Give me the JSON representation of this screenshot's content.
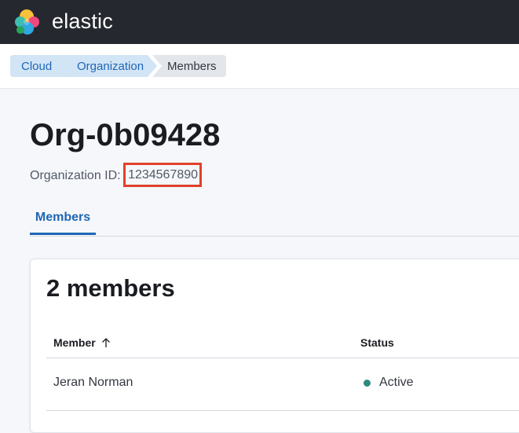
{
  "header": {
    "brand": "elastic"
  },
  "breadcrumbs": [
    "Cloud",
    "Organization",
    "Members"
  ],
  "page": {
    "title": "Org-0b09428",
    "org_id_label": "Organization ID:",
    "org_id_value": "1234567890"
  },
  "tabs": [
    {
      "label": "Members",
      "active": true
    }
  ],
  "members_panel": {
    "title": "2 members",
    "columns": [
      "Member",
      "Status"
    ],
    "rows": [
      {
        "member": "Jeran Norman",
        "status": "Active"
      }
    ]
  },
  "colors": {
    "topbar": "#25282f",
    "link": "#1f66b5",
    "highlight_box": "#e0422a",
    "status_active": "#2e8a7e"
  }
}
